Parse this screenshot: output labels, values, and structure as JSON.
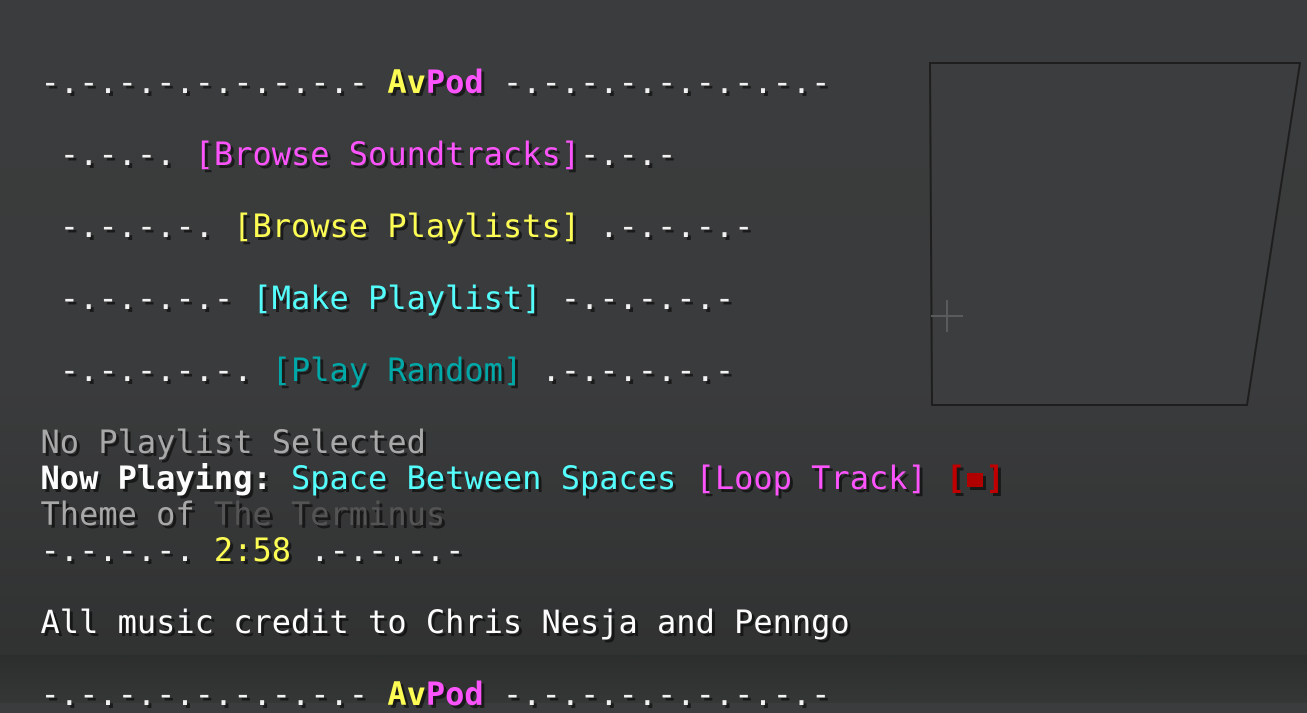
{
  "header": {
    "left_dashes": "-.-.-.-.-.-.-.-.- ",
    "brand_part1": "Av",
    "brand_part2": "Pod",
    "right_dashes": " -.-.-.-.-.-.-.-.-"
  },
  "menu": {
    "soundtracks": {
      "left_dashes": " -.-.-. ",
      "label": "[Browse Soundtracks]",
      "right_dashes": "-.-.-"
    },
    "playlists": {
      "left_dashes": " -.-.-.-. ",
      "label": "[Browse Playlists]",
      "right_dashes": " .-.-.-.-"
    },
    "make_playlist": {
      "left_dashes": " -.-.-.-.- ",
      "label": "[Make Playlist]",
      "right_dashes": " -.-.-.-.-"
    },
    "play_random": {
      "left_dashes": " -.-.-.-.-. ",
      "label": "[Play Random]",
      "right_dashes": " .-.-.-.-.-"
    }
  },
  "status": {
    "playlist": "No Playlist Selected",
    "now_playing_label": "Now Playing:",
    "track": "Space Between Spaces",
    "loop_label": "[Loop Track]",
    "stop_open": "[",
    "stop_close": "]",
    "album_prefix": "Theme of ",
    "album_name": "The Terminus",
    "time_left_dashes": "-.-.-.-. ",
    "time": "2:58",
    "time_right_dashes": " .-.-.-.-"
  },
  "credit": "All music credit to Chris Nesja and Penngo",
  "footer": {
    "left_dashes": "-.-.-.-.-.-.-.-.- ",
    "brand_part1": "Av",
    "brand_part2": "Pod",
    "right_dashes": " -.-.-.-.-.-.-.-.-"
  },
  "colors": {
    "yellow": "#fcfc54",
    "magenta": "#fc54fc",
    "aqua": "#54fcfc",
    "dark_aqua": "#00a8a8",
    "gray": "#a8a8a8",
    "dark_gray": "#545454",
    "red": "#c00000"
  },
  "icons": {
    "stop": "stop-square-icon",
    "crosshair": "crosshair-icon"
  }
}
